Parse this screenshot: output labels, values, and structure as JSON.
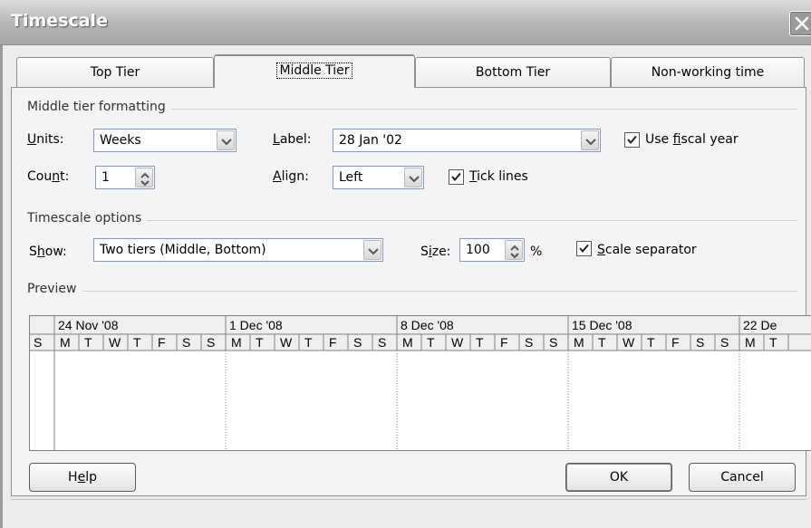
{
  "window": {
    "title": "Timescale",
    "close_icon": "close-icon"
  },
  "tabs": [
    {
      "label": "Top Tier",
      "active": false
    },
    {
      "label": "Middle Tier",
      "active": true
    },
    {
      "label": "Bottom Tier",
      "active": false
    },
    {
      "label": "Non-working time",
      "active": false
    }
  ],
  "middle_tier": {
    "group_label": "Middle tier formatting",
    "units_label_u": "U",
    "units_label_rest": "nits:",
    "units_value": "Weeks",
    "label_label_u": "L",
    "label_label_rest": "abel:",
    "label_value": "28 Jan '02",
    "use_fiscal_label_pre": "Use ",
    "use_fiscal_label_u": "f",
    "use_fiscal_label_rest": "iscal year",
    "use_fiscal_checked": true,
    "count_label_pre": "Cou",
    "count_label_u": "n",
    "count_label_rest": "t:",
    "count_value": "1",
    "align_label_u": "A",
    "align_label_rest": "lign:",
    "align_value": "Left",
    "tick_lines_label_u": "T",
    "tick_lines_label_rest": "ick lines",
    "tick_lines_checked": true
  },
  "timescale_options": {
    "group_label": "Timescale options",
    "show_label_pre": "S",
    "show_label_u": "h",
    "show_label_rest": "ow:",
    "show_value": "Two tiers (Middle, Bottom)",
    "size_label_pre": "S",
    "size_label_u": "i",
    "size_label_rest": "ze:",
    "size_value": "100",
    "size_unit": "%",
    "scale_separator_label_u": "S",
    "scale_separator_label_rest": "cale separator",
    "scale_separator_checked": true
  },
  "preview": {
    "group_label": "Preview",
    "weeks": [
      "24 Nov '08",
      "1 Dec '08",
      "8 Dec '08",
      "15 Dec '08",
      "22 De"
    ],
    "days_leading": [
      "S"
    ],
    "days": [
      "M",
      "T",
      "W",
      "T",
      "F",
      "S",
      "S"
    ],
    "days_trailing": [
      "M",
      "T"
    ]
  },
  "buttons": {
    "help_pre": "H",
    "help_u": "e",
    "help_rest": "lp",
    "ok": "OK",
    "cancel": "Cancel"
  }
}
